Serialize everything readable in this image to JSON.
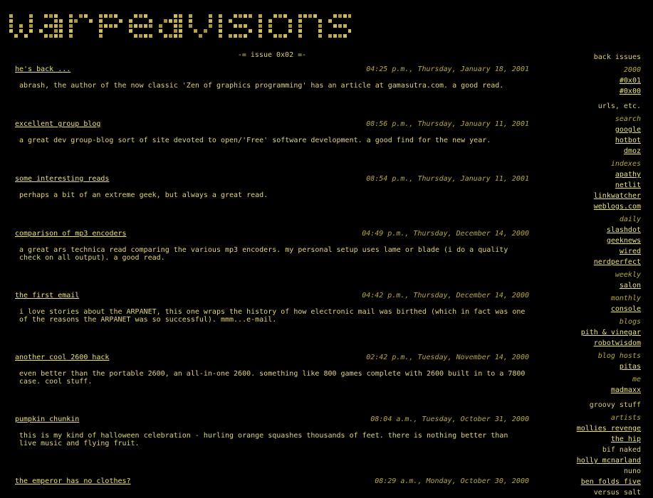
{
  "site": {
    "logo_text": "warpedvisions"
  },
  "issue_header": "-= issue 0x02 =-",
  "posts": [
    {
      "title": "he's back ...",
      "date": "04:25 p.m., Thursday, January 18, 2001",
      "body": "abrash, the author of the now classic 'Zen of graphics programming' has an article at gamasutra.com. a good read."
    },
    {
      "title": "excellent group blog",
      "date": "08:56 p.m., Thursday, January 11, 2001",
      "body": "a great dev group-blog sort of site devoted to open/'Free' software development. a good find for the new year."
    },
    {
      "title": "some interesting reads",
      "date": "08:54 p.m., Thursday, January 11, 2001",
      "body": "perhaps a bit of an extreme geek, but always a great read."
    },
    {
      "title": "comparison of mp3 encoders",
      "date": "04:49 p.m., Thursday, December 14, 2000",
      "body": "a great ars technica read comparing the various mp3 encoders. my personal setup uses lame or blade (i do a quality\ncheck on all output). a good read."
    },
    {
      "title": "the first email",
      "date": "04:42 p.m., Thursday, December 14, 2000",
      "body": "i love stories about the ARPANET, this one wraps the history of how electronic mail was birthed (which in fact was one\nof the reasons the ARPANET was so successful). mmm...e-mail."
    },
    {
      "title": "another cool 2600 hack",
      "date": "02:42 p.m., Tuesday, November 14, 2000",
      "body": "even better than the portable 2600, an all-in-one 2600. something like 800 games complete with 2600 built in to a 7800\ncase. cool stuff."
    },
    {
      "title": "pumpkin chunkin",
      "date": "08:04 a.m., Tuesday, October 31, 2000",
      "body": "this is my kind of halloween celebration - hurling orange squashes thousands of feet. there is nothing better than\nlive music and flying fruit."
    },
    {
      "title": "the emperor has no clothes?",
      "date": "08:29 a.m., Monday, October 30, 2000",
      "body": ""
    }
  ],
  "sidebar": {
    "back_issues": {
      "heading": "back issues",
      "year": "2000",
      "links": [
        "#0x01",
        "#0x00"
      ]
    },
    "urls_heading": "urls, etc.",
    "groups": [
      {
        "label": "search",
        "links": [
          "google",
          "hotbot",
          "dmoz"
        ]
      },
      {
        "label": "indexes",
        "links": [
          "apathy",
          "netlit",
          "linkwatcher",
          "weblogs.com"
        ]
      },
      {
        "label": "daily",
        "links": [
          "slashdot",
          "geeknews",
          "wired",
          "nerdperfect"
        ]
      },
      {
        "label": "weekly",
        "links": [
          "salon"
        ]
      },
      {
        "label": "monthly",
        "links": [
          "console"
        ]
      },
      {
        "label": "blogs",
        "links": [
          "pith & vinegar",
          "robotwisdom"
        ]
      },
      {
        "label": "blog hosts",
        "links": [
          "pitas"
        ]
      },
      {
        "label": "me",
        "links": [
          "madmaxx"
        ]
      }
    ],
    "groovy_heading": "groovy stuff",
    "artists_label": "artists",
    "artists": [
      {
        "name": "mollies revenge",
        "link": true
      },
      {
        "name": "the hip",
        "link": true
      },
      {
        "name": "bif naked",
        "link": false
      },
      {
        "name": "holly mcnarland",
        "link": true
      },
      {
        "name": "nuno",
        "link": false
      },
      {
        "name": "ben folds five",
        "link": true
      },
      {
        "name": "versus salt",
        "link": false
      }
    ]
  },
  "colors": {
    "background": "#000000",
    "text": "#d8cc7a",
    "link": "#e8e07a",
    "muted": "#b6a83e"
  }
}
